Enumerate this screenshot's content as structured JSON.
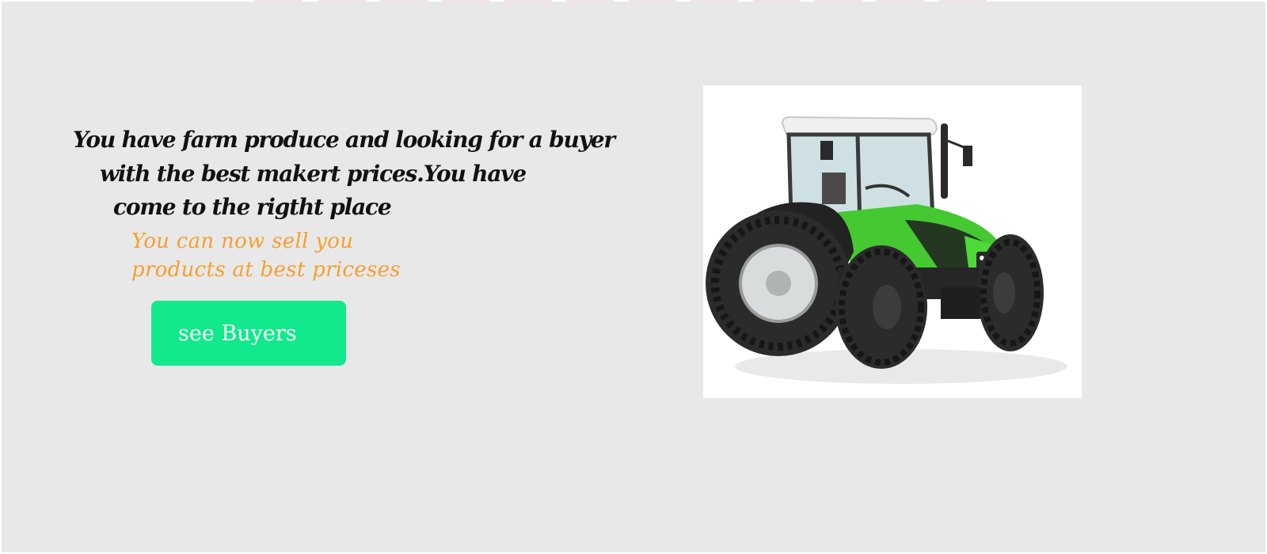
{
  "hero": {
    "headline_lines": [
      "You have  farm produce and looking for a buyer",
      "with the best makert prices.You have",
      "come to the rigtht place"
    ],
    "subline_lines": [
      "You can now sell you",
      "products at best priceses"
    ],
    "cta_label": "see Buyers"
  },
  "image": {
    "subject": "green tractor"
  },
  "colors": {
    "background": "#e8e8e8",
    "headline": "#111111",
    "subline": "#f5a030",
    "cta": "#12e88c",
    "cta_text": "#ffffff",
    "tractor_green": "#45c832"
  }
}
